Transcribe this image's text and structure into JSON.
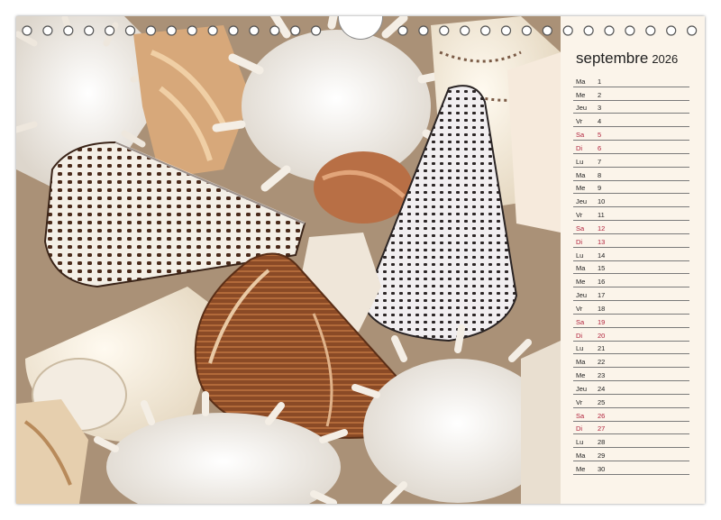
{
  "calendar": {
    "month": "septembre",
    "year": "2026",
    "days": [
      {
        "dn": "Ma",
        "num": "1",
        "we": false
      },
      {
        "dn": "Me",
        "num": "2",
        "we": false
      },
      {
        "dn": "Jeu",
        "num": "3",
        "we": false
      },
      {
        "dn": "Vr",
        "num": "4",
        "we": false
      },
      {
        "dn": "Sa",
        "num": "5",
        "we": true
      },
      {
        "dn": "Di",
        "num": "6",
        "we": true
      },
      {
        "dn": "Lu",
        "num": "7",
        "we": false
      },
      {
        "dn": "Ma",
        "num": "8",
        "we": false
      },
      {
        "dn": "Me",
        "num": "9",
        "we": false
      },
      {
        "dn": "Jeu",
        "num": "10",
        "we": false
      },
      {
        "dn": "Vr",
        "num": "11",
        "we": false
      },
      {
        "dn": "Sa",
        "num": "12",
        "we": true
      },
      {
        "dn": "Di",
        "num": "13",
        "we": true
      },
      {
        "dn": "Lu",
        "num": "14",
        "we": false
      },
      {
        "dn": "Ma",
        "num": "15",
        "we": false
      },
      {
        "dn": "Me",
        "num": "16",
        "we": false
      },
      {
        "dn": "Jeu",
        "num": "17",
        "we": false
      },
      {
        "dn": "Vr",
        "num": "18",
        "we": false
      },
      {
        "dn": "Sa",
        "num": "19",
        "we": true
      },
      {
        "dn": "Di",
        "num": "20",
        "we": true
      },
      {
        "dn": "Lu",
        "num": "21",
        "we": false
      },
      {
        "dn": "Ma",
        "num": "22",
        "we": false
      },
      {
        "dn": "Me",
        "num": "23",
        "we": false
      },
      {
        "dn": "Jeu",
        "num": "24",
        "we": false
      },
      {
        "dn": "Vr",
        "num": "25",
        "we": false
      },
      {
        "dn": "Sa",
        "num": "26",
        "we": true
      },
      {
        "dn": "Di",
        "num": "27",
        "we": true
      },
      {
        "dn": "Lu",
        "num": "28",
        "we": false
      },
      {
        "dn": "Ma",
        "num": "29",
        "we": false
      },
      {
        "dn": "Me",
        "num": "30",
        "we": false
      }
    ]
  },
  "colors": {
    "weekend": "#b0203a",
    "panel_bg": "#fbf4ea",
    "ruling": "#7a7a7a"
  },
  "photo": {
    "subject_icon": "seashells-photo"
  }
}
